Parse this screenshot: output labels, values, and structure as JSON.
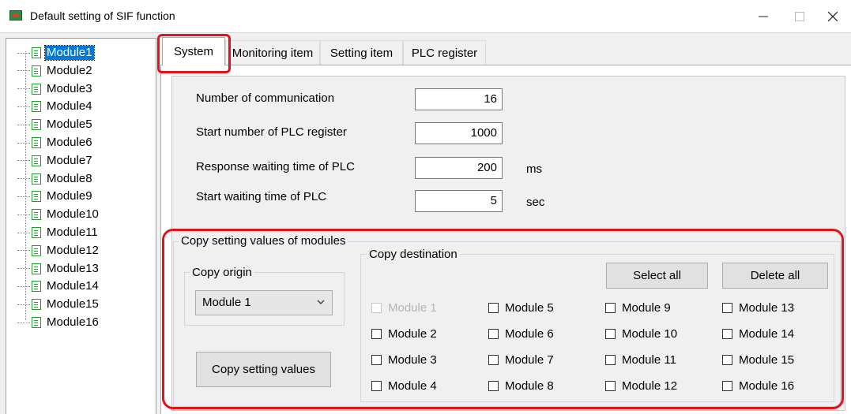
{
  "window": {
    "title": "Default setting of SIF function"
  },
  "tree": {
    "items": [
      "Module1",
      "Module2",
      "Module3",
      "Module4",
      "Module5",
      "Module6",
      "Module7",
      "Module8",
      "Module9",
      "Module10",
      "Module11",
      "Module12",
      "Module13",
      "Module14",
      "Module15",
      "Module16"
    ],
    "selected": "Module1"
  },
  "tabs": [
    "System",
    "Monitoring item",
    "Setting item",
    "PLC register"
  ],
  "active_tab": "System",
  "system": {
    "num_comm_label": "Number of communication",
    "num_comm_value": "16",
    "start_reg_label": "Start number of PLC register",
    "start_reg_value": "1000",
    "resp_wait_label": "Response waiting time of PLC",
    "resp_wait_value": "200",
    "resp_wait_unit": "ms",
    "start_wait_label": "Start waiting time of PLC",
    "start_wait_value": "5",
    "start_wait_unit": "sec"
  },
  "copy": {
    "group_title": "Copy setting values of modules",
    "origin_title": "Copy origin",
    "origin_value": "Module 1",
    "copy_button": "Copy setting values",
    "dest_title": "Copy destination",
    "select_all": "Select all",
    "delete_all": "Delete all",
    "destinations": [
      "Module 1",
      "Module 2",
      "Module 3",
      "Module 4",
      "Module 5",
      "Module 6",
      "Module 7",
      "Module 8",
      "Module 9",
      "Module 10",
      "Module 11",
      "Module 12",
      "Module 13",
      "Module 14",
      "Module 15",
      "Module 16"
    ]
  }
}
